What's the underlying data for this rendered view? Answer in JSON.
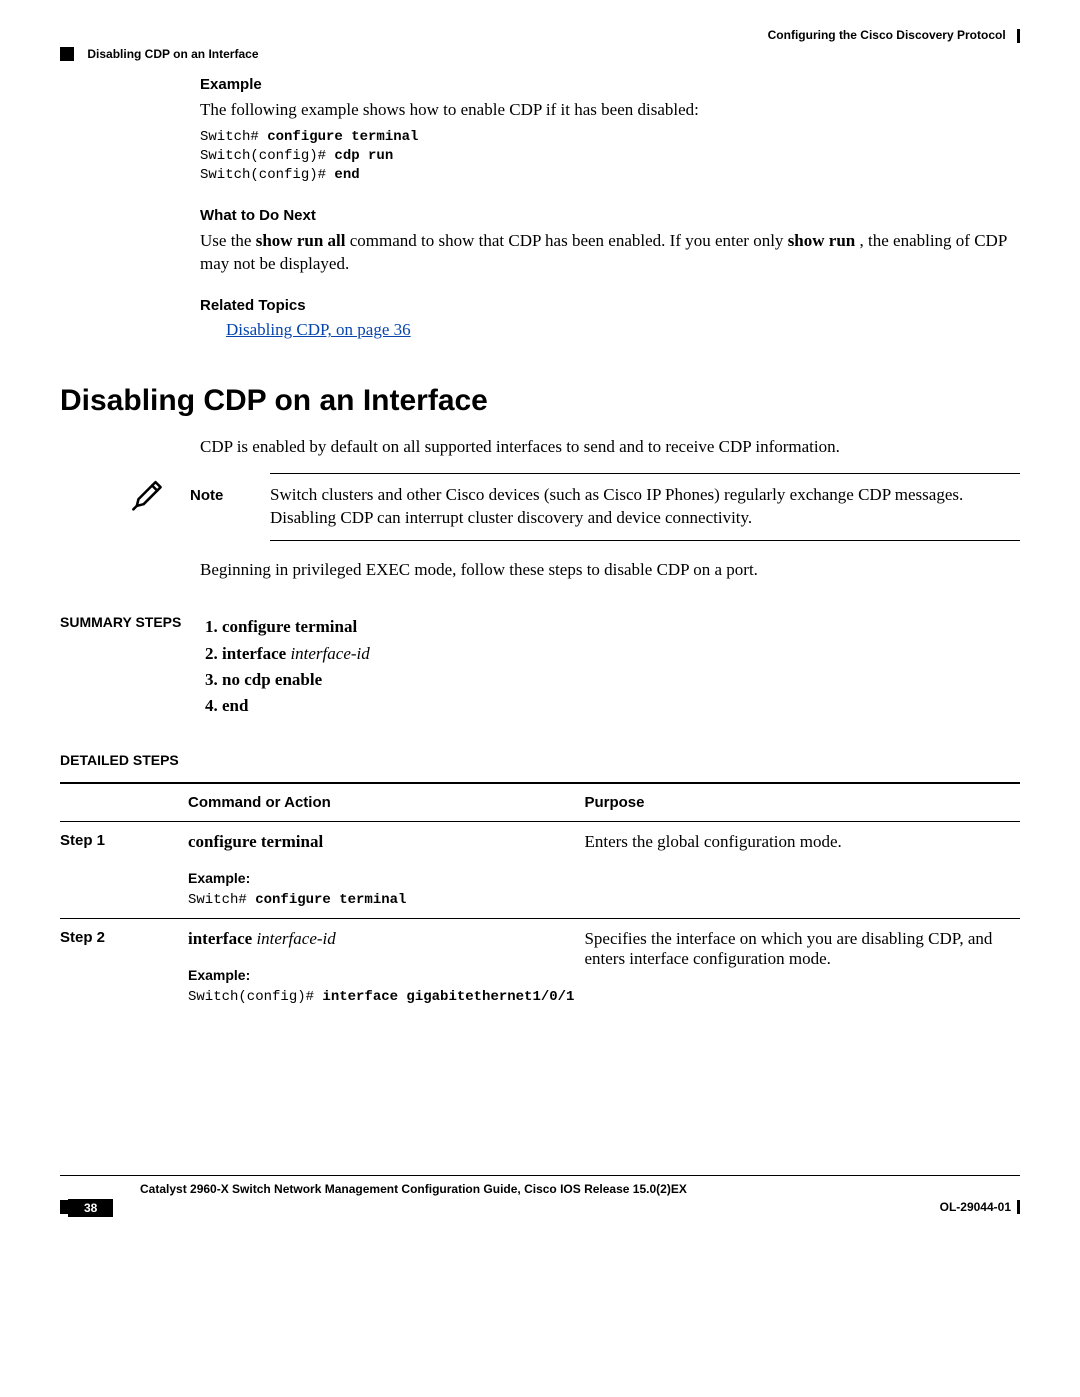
{
  "header": {
    "chapter": "Configuring the Cisco Discovery Protocol",
    "section": "Disabling CDP on an Interface"
  },
  "example_section": {
    "heading": "Example",
    "intro": "The following example shows how to enable CDP if it has been disabled:",
    "code_l1_prompt": "Switch# ",
    "code_l1_cmd": "configure terminal",
    "code_l2_prompt": "Switch(config)# ",
    "code_l2_cmd": "cdp run",
    "code_l3_prompt": "Switch(config)# ",
    "code_l3_cmd": "end"
  },
  "what_next": {
    "heading": "What to Do Next",
    "text_a": "Use the ",
    "cmd1": "show run all",
    "text_b": " command to show that CDP has been enabled. If you enter only ",
    "cmd2": "show run",
    "text_c": " , the enabling of CDP may not be displayed."
  },
  "related": {
    "heading": "Related Topics",
    "link": "Disabling CDP,  on page 36"
  },
  "h1": "Disabling CDP on an Interface",
  "intro_para": "CDP is enabled by default on all supported interfaces to send and to receive CDP information.",
  "note": {
    "label": "Note",
    "text": "Switch clusters and other Cisco devices (such as Cisco IP Phones) regularly exchange CDP messages. Disabling CDP can interrupt cluster discovery and device connectivity."
  },
  "begin_text": "Beginning in privileged EXEC mode, follow these steps to disable CDP on a port.",
  "summary": {
    "label": "SUMMARY STEPS",
    "s1": "configure terminal",
    "s2a": "interface",
    "s2b": "interface-id",
    "s3": "no cdp enable",
    "s4": "end"
  },
  "detailed": {
    "label": "DETAILED STEPS",
    "col1": "",
    "col2": "Command or Action",
    "col3": "Purpose",
    "rows": [
      {
        "step": "Step 1",
        "cmd_bold": "configure terminal",
        "cmd_italic": "",
        "ex_label": "Example:",
        "ex_prompt": "Switch# ",
        "ex_cmd": "configure terminal",
        "purpose": "Enters the global configuration mode."
      },
      {
        "step": "Step 2",
        "cmd_bold": "interface",
        "cmd_italic": "interface-id",
        "ex_label": "Example:",
        "ex_prompt": "Switch(config)# ",
        "ex_cmd": "interface gigabitethernet1/0/1",
        "purpose": "Specifies the interface on which you are disabling CDP, and enters interface configuration mode."
      }
    ]
  },
  "footer": {
    "title": "Catalyst 2960-X Switch Network Management Configuration Guide, Cisco IOS Release 15.0(2)EX",
    "page": "38",
    "doc_id": "OL-29044-01"
  }
}
